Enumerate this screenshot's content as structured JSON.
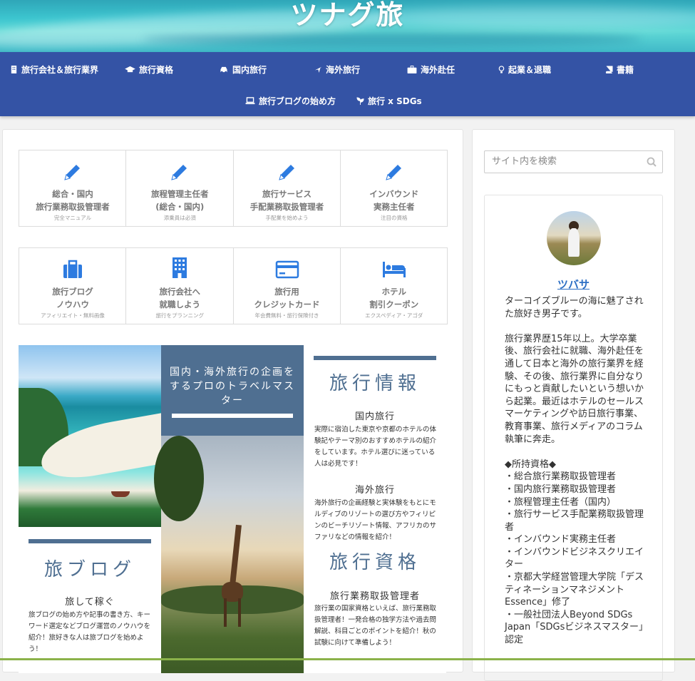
{
  "site": {
    "title": "ツナグ旅"
  },
  "nav": [
    {
      "label": "旅行会社＆旅行業界",
      "icon": "building-icon"
    },
    {
      "label": "旅行資格",
      "icon": "graduation-cap-icon"
    },
    {
      "label": "国内旅行",
      "icon": "car-icon"
    },
    {
      "label": "海外旅行",
      "icon": "plane-icon"
    },
    {
      "label": "海外赴任",
      "icon": "briefcase-icon"
    },
    {
      "label": "起業＆退職",
      "icon": "lightbulb-icon"
    },
    {
      "label": "書籍",
      "icon": "book-icon"
    },
    {
      "label": "旅行ブログの始め方",
      "icon": "laptop-icon"
    },
    {
      "label": "旅行 x SDGs",
      "icon": "seedling-icon"
    }
  ],
  "grid1": [
    {
      "title1": "総合・国内",
      "title2": "旅行業務取扱管理者",
      "sub": "完全マニュアル",
      "icon": "pencil-icon"
    },
    {
      "title1": "旅程管理主任者",
      "title2": "(総合・国内)",
      "sub": "添乗員は必須",
      "icon": "pencil-icon"
    },
    {
      "title1": "旅行サービス",
      "title2": "手配業務取扱管理者",
      "sub": "手配業を始めよう",
      "icon": "pencil-icon"
    },
    {
      "title1": "インバウンド",
      "title2": "実務主任者",
      "sub": "注目の資格",
      "icon": "pencil-icon"
    }
  ],
  "grid2": [
    {
      "title1": "旅行ブログ",
      "title2": "ノウハウ",
      "sub": "アフィリエイト・無料画像",
      "icon": "suitcase-icon"
    },
    {
      "title1": "旅行会社へ",
      "title2": "就職しよう",
      "sub": "旅行をプランニング",
      "icon": "office-building-icon"
    },
    {
      "title1": "旅行用",
      "title2": "クレジットカード",
      "sub": "年会費無料・旅行保険付き",
      "icon": "credit-card-icon"
    },
    {
      "title1": "ホテル",
      "title2": "割引クーポン",
      "sub": "エクスペディア・アゴダ",
      "icon": "bed-icon"
    }
  ],
  "collage": {
    "box_title": "国内・海外旅行の企画をするプロのトラベルマスター",
    "blog_heading": "旅ブログ",
    "blog_sub": "旅して稼ぐ",
    "blog_text": "旅ブログの始め方や記事の書き方、キーワード選定などブログ運営のノウハウを紹介！旅好きな人は旅ブログを始めよう！",
    "info_heading": "旅行情報",
    "domestic_sub": "国内旅行",
    "domestic_text": "実際に宿泊した東京や京都のホテルの体験記やテーマ別のおすすめホテルの紹介をしています。ホテル選びに迷っている人は必見です！",
    "overseas_sub": "海外旅行",
    "overseas_text": "海外旅行の企画経験と実体験をもとにモルディブのリゾートの選び方やフィリピンのビーチリゾート情報、アフリカのサファリなどの情報を紹介！",
    "qual_heading": "旅行資格",
    "qual_sub": "旅行業務取扱管理者",
    "qual_text": "旅行業の国家資格といえば、旅行業務取扱管理者！一発合格の独学方法や過去問解説、科目ごとのポイントを紹介！秋の試験に向けて準備しよう！"
  },
  "sidebar": {
    "search_placeholder": "サイト内を検索",
    "name": "ツバサ",
    "bio": "ターコイズブルーの海に魅了された旅好き男子です。\n\n旅行業界歴15年以上。大学卒業後、旅行会社に就職、海外赴任を通して日本と海外の旅行業界を経験、その後、旅行業界に自分なりにもっと貢献したいという想いから起業。最近はホテルのセールスマーケティングや訪日旅行事業、教育事業、旅行メディアのコラム執筆に奔走。\n\n◆所持資格◆\n・総合旅行業務取扱管理者\n・国内旅行業務取扱管理者\n・旅程管理主任者（国内）\n・旅行サービス手配業務取扱管理者\n・インバウンド実務主任者\n・インバウンドビジネスクリエイター\n・京都大学経営管理大学院「デスティネーションマネジメントEssence」修了\n・一般社団法人Beyond SDGs Japan「SDGsビジネスマスター」認定"
  },
  "colors": {
    "nav_bg": "#3453a5",
    "accent_icon": "#2d7be0",
    "slate": "#4f6f91",
    "link": "#2d6fc4"
  }
}
